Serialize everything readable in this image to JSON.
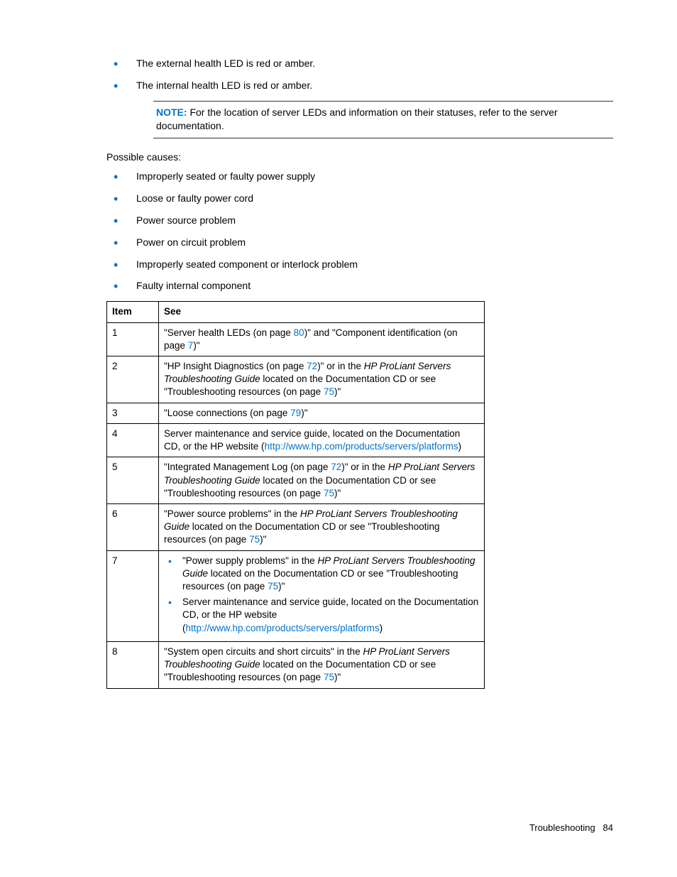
{
  "top_bullets": [
    "The external health LED is red or amber.",
    "The internal health LED is red or amber."
  ],
  "note": {
    "label": "NOTE:",
    "text": "  For the location of server LEDs and information on their statuses, refer to the server documentation."
  },
  "causes_heading": "Possible causes:",
  "causes": [
    "Improperly seated or faulty power supply",
    "Loose or faulty power cord",
    "Power source problem",
    "Power on circuit problem",
    "Improperly seated component or interlock problem",
    "Faulty internal component"
  ],
  "table": {
    "headers": {
      "item": "Item",
      "see": "See"
    },
    "rows": {
      "r1": {
        "item": "1",
        "t1": "\"Server health LEDs (on page ",
        "l1": "80",
        "t2": ")\" and \"Component identification (on page ",
        "l2": "7",
        "t3": ")\""
      },
      "r2": {
        "item": "2",
        "t1": "\"HP Insight Diagnostics (on page ",
        "l1": "72",
        "t2": ")\" or in the ",
        "i1": "HP ProLiant Servers Troubleshooting Guide",
        "t3": " located on the Documentation CD or see \"Troubleshooting resources (on page ",
        "l2": "75",
        "t4": ")\""
      },
      "r3": {
        "item": "3",
        "t1": "\"Loose connections (on page ",
        "l1": "79",
        "t2": ")\""
      },
      "r4": {
        "item": "4",
        "t1": "Server maintenance and service guide, located on the Documentation CD, or the HP website (",
        "l1": "http://www.hp.com/products/servers/platforms",
        "t2": ")"
      },
      "r5": {
        "item": "5",
        "t1": "\"Integrated Management Log (on page ",
        "l1": "72",
        "t2": ")\" or in the ",
        "i1": "HP ProLiant Servers Troubleshooting Guide",
        "t3": " located on the Documentation CD or see \"Troubleshooting resources (on page ",
        "l2": "75",
        "t4": ")\""
      },
      "r6": {
        "item": "6",
        "t1": "\"Power source problems\" in the ",
        "i1": "HP ProLiant Servers Troubleshooting Guide",
        "t2": " located on the Documentation CD or see \"Troubleshooting resources (on page ",
        "l1": "75",
        "t3": ")\""
      },
      "r7": {
        "item": "7",
        "b1": {
          "t1": "\"Power supply problems\" in the ",
          "i1": "HP ProLiant Servers Troubleshooting Guide",
          "t2": " located on the Documentation CD or see \"Troubleshooting resources (on page ",
          "l1": "75",
          "t3": ")\""
        },
        "b2": {
          "t1": "Server maintenance and service guide, located on the Documentation CD, or the HP website (",
          "l1": "http://www.hp.com/products/servers/platforms",
          "t2": ")"
        }
      },
      "r8": {
        "item": "8",
        "t1": "\"System open circuits and short circuits\" in the ",
        "i1": "HP ProLiant Servers Troubleshooting Guide",
        "t2": " located on the Documentation CD or see \"Troubleshooting resources (on page ",
        "l1": "75",
        "t3": ")\""
      }
    }
  },
  "footer": {
    "section": "Troubleshooting",
    "page": "84"
  }
}
